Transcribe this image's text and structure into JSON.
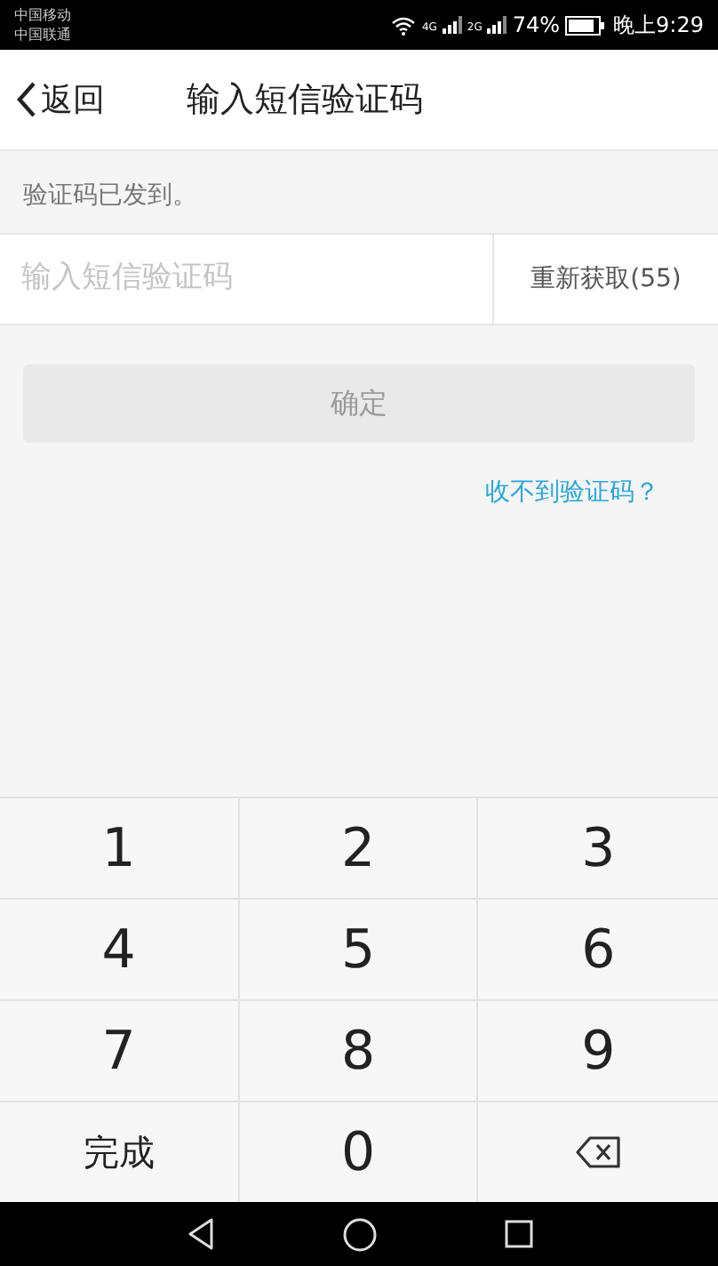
{
  "status_bar": {
    "carriers": [
      "中国移动",
      "中国联通"
    ],
    "network_1": "4G",
    "network_2": "2G",
    "battery": "74%",
    "time": "晚上9:29"
  },
  "header": {
    "back": "返回",
    "title": "输入短信验证码"
  },
  "notice": "验证码已发到。",
  "code_field": {
    "placeholder": "输入短信验证码"
  },
  "resend_button": "重新获取(55)",
  "confirm_button": {
    "label": "确定",
    "disabled": true
  },
  "help_link": "收不到验证码？",
  "keypad": [
    {
      "kind": "digit",
      "label": "1"
    },
    {
      "kind": "digit",
      "label": "2"
    },
    {
      "kind": "digit",
      "label": "3"
    },
    {
      "kind": "digit",
      "label": "4"
    },
    {
      "kind": "digit",
      "label": "5"
    },
    {
      "kind": "digit",
      "label": "6"
    },
    {
      "kind": "digit",
      "label": "7"
    },
    {
      "kind": "digit",
      "label": "8"
    },
    {
      "kind": "digit",
      "label": "9"
    },
    {
      "kind": "text",
      "label": "完成"
    },
    {
      "kind": "digit",
      "label": "0"
    },
    {
      "kind": "backspace"
    }
  ]
}
